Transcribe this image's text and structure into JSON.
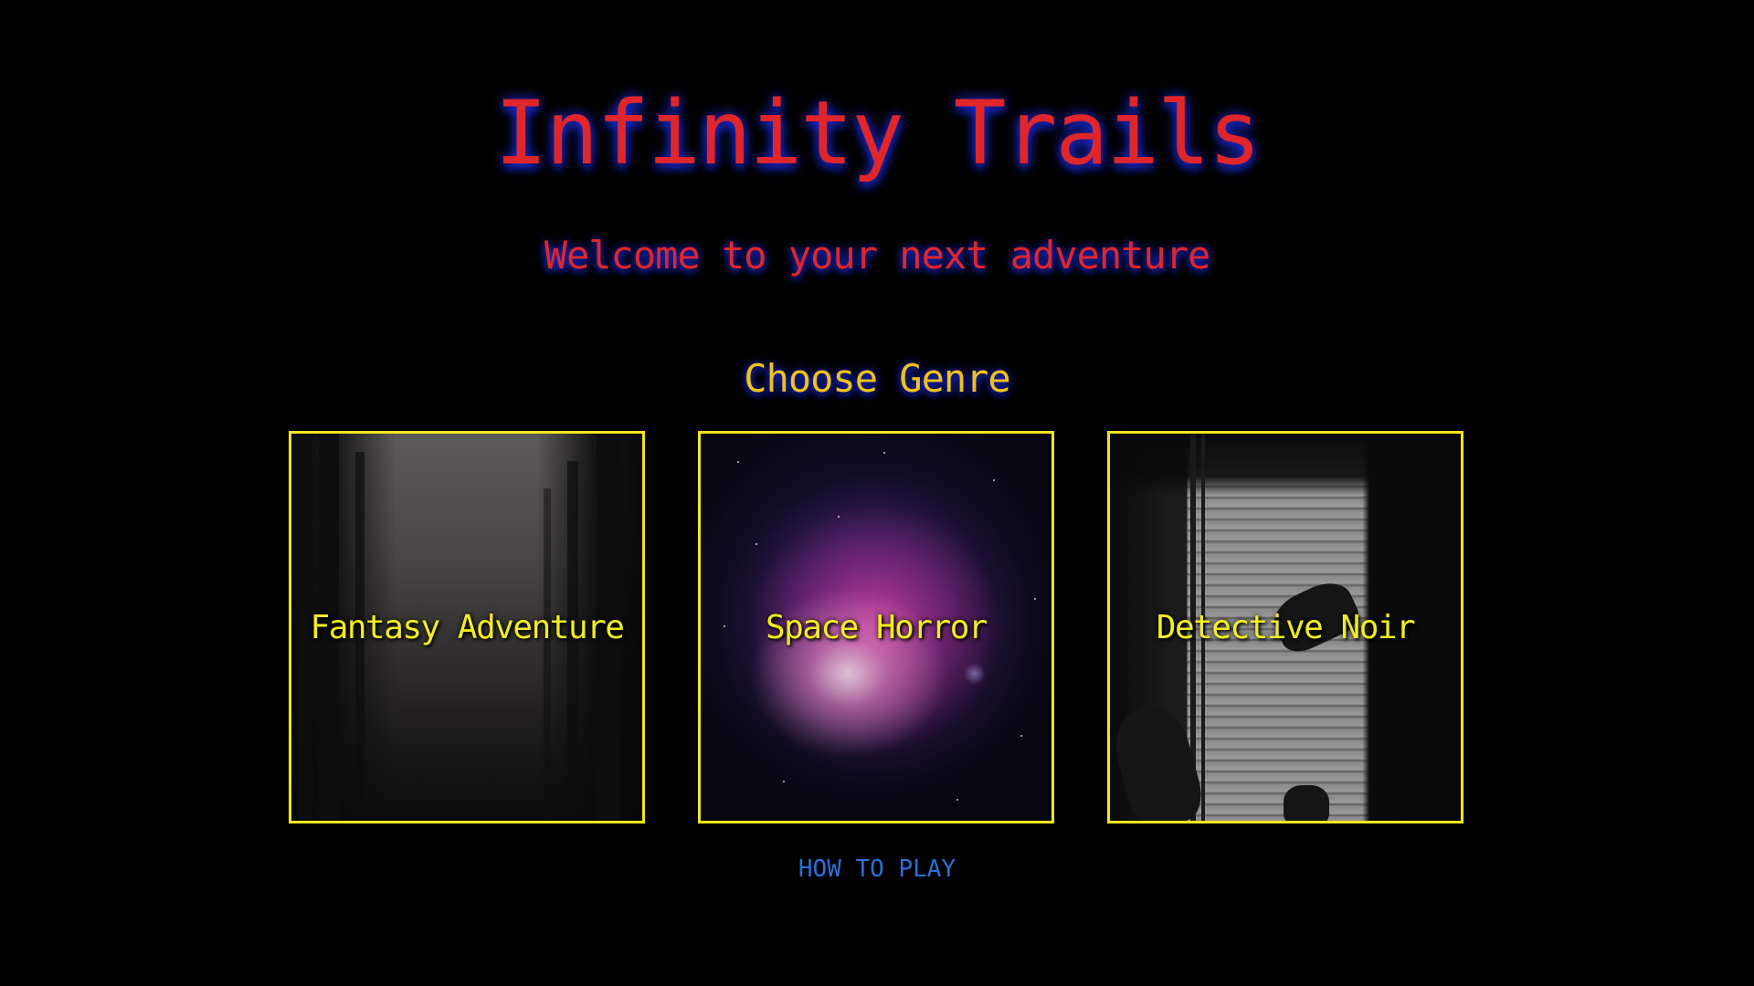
{
  "header": {
    "title": "Infinity Trails",
    "subtitle": "Welcome to your next adventure"
  },
  "genre_section": {
    "heading": "Choose Genre",
    "cards": [
      {
        "label": "Fantasy Adventure",
        "image": "misty-forest"
      },
      {
        "label": "Space Horror",
        "image": "nebula"
      },
      {
        "label": "Detective Noir",
        "image": "window-blinds-shadow"
      }
    ]
  },
  "footer": {
    "how_to_play": "HOW TO PLAY"
  },
  "colors": {
    "background": "#000000",
    "title": "#e0262a",
    "heading": "#f0c21a",
    "card_border": "#f2e51c",
    "card_label": "#f2ee1f",
    "link": "#2b6fd6",
    "glow": "#1e32ff"
  }
}
